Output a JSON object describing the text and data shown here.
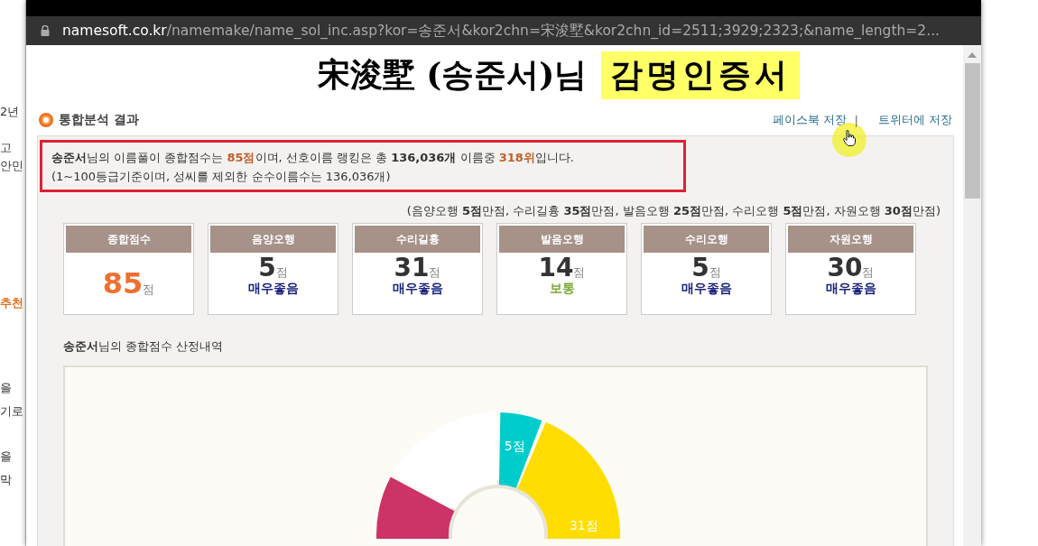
{
  "background_page": {
    "fragments": [
      "2년",
      "고",
      "안민",
      "추천",
      "을",
      "기로",
      "을",
      "막"
    ]
  },
  "address_bar": {
    "domain": "namesoft.co.kr",
    "path": "/namemake/name_sol_inc.asp?kor=송준서&kor2chn=宋浚墅&kor2chn_id=2511;3929;2323;&name_length=2..."
  },
  "certificate": {
    "title": "宋浚墅 (송준서)님",
    "highlight": "감명인증서"
  },
  "section": {
    "title": "통합분석 결과",
    "links": [
      "페이스북 저장",
      "트위터에 저장"
    ],
    "separator": "|"
  },
  "summary": {
    "lines": [
      "**송준서**님의 이름풀이 종합점수는 **85점**이며, 선호이름 랭킹은 총 **136,036개** 이름중 **318위**입니다.",
      "(1~100등급기준이며, 성씨를 제외한 순수이름수는 136,036개)"
    ]
  },
  "max_scores": "(음양오행 **5점**만점, 수리길흉 **35점**만점, 발음오행 **25점**만점, 수리오행 **5점**만점, 자원오행 **30점**만점)",
  "score_cards": [
    {
      "kind": "total",
      "label": "종합점수",
      "value": "85",
      "unit": "점"
    },
    {
      "kind": "part",
      "label": "음양오행",
      "value": "5",
      "unit": "점",
      "grade": "매우좋음",
      "color": "#1a237e"
    },
    {
      "kind": "part",
      "label": "수리길흉",
      "value": "31",
      "unit": "점",
      "grade": "매우좋음",
      "color": "#1a237e"
    },
    {
      "kind": "part",
      "label": "발음오행",
      "value": "14",
      "unit": "점",
      "grade": "보통",
      "color": "#7cab3a"
    },
    {
      "kind": "part",
      "label": "수리오행",
      "value": "5",
      "unit": "점",
      "grade": "매우좋음",
      "color": "#1a237e"
    },
    {
      "kind": "part",
      "label": "자원오행",
      "value": "30",
      "unit": "점",
      "grade": "매우좋음",
      "color": "#1a237e"
    }
  ],
  "breakdown": {
    "title": "**송준서**님의 종합점수 산정내역",
    "slice_labels": [
      "5점",
      "31점"
    ]
  }
}
